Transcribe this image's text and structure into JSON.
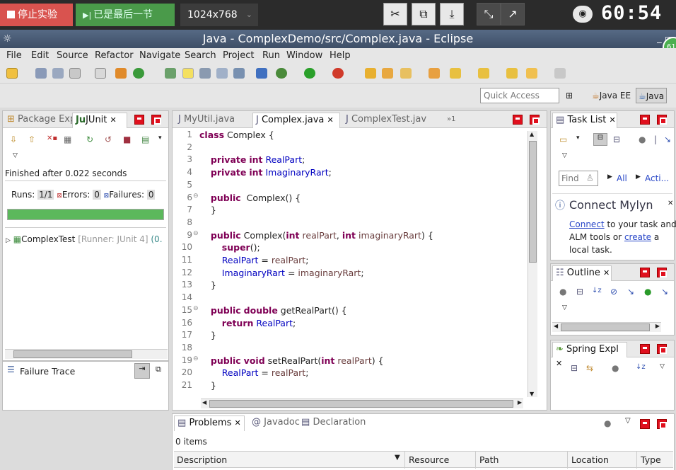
{
  "recorder": {
    "stop_label": "停止实验",
    "last_label": "已是最后一节",
    "resolution": "1024x768",
    "timer": "60:54",
    "badge": "61"
  },
  "window": {
    "title": "Java - ComplexDemo/src/Complex.java - Eclipse"
  },
  "menu": [
    "File",
    "Edit",
    "Source",
    "Refactor",
    "Navigate",
    "Search",
    "Project",
    "Run",
    "Window",
    "Help"
  ],
  "quick_access": {
    "placeholder": "Quick Access"
  },
  "perspectives": [
    "Java EE",
    "Java"
  ],
  "left_panel": {
    "tab_package": "Package Exp",
    "tab_junit": "JUnit",
    "finished": "Finished after 0.022 seconds",
    "runs_label": "Runs:",
    "runs_value": "1/1",
    "errors_label": "Errors:",
    "errors_value": "0",
    "failures_label": "Failures:",
    "failures_value": "0",
    "progress": 1.0,
    "progress_color": "#5cb85c",
    "test_name": "ComplexTest",
    "test_runner": "[Runner: JUnit 4]",
    "test_time": "(0.",
    "failure_trace": "Failure Trace"
  },
  "editor": {
    "tabs": [
      "MyUtil.java",
      "Complex.java",
      "ComplexTest.jav"
    ],
    "overflow": "»1",
    "lines": [
      {
        "n": "1",
        "fold": "",
        "segs": [
          [
            "kw",
            "class"
          ],
          [
            "t",
            " Complex {"
          ]
        ]
      },
      {
        "n": "2",
        "fold": "",
        "segs": []
      },
      {
        "n": "3",
        "fold": "",
        "segs": [
          [
            "t",
            "    "
          ],
          [
            "kw",
            "private"
          ],
          [
            "t",
            " "
          ],
          [
            "kw",
            "int"
          ],
          [
            "t",
            " "
          ],
          [
            "fld",
            "RealPart"
          ],
          [
            "t",
            ";"
          ]
        ]
      },
      {
        "n": "4",
        "fold": "",
        "segs": [
          [
            "t",
            "    "
          ],
          [
            "kw",
            "private"
          ],
          [
            "t",
            " "
          ],
          [
            "kw",
            "int"
          ],
          [
            "t",
            " "
          ],
          [
            "fld",
            "ImaginaryRart"
          ],
          [
            "t",
            ";"
          ]
        ]
      },
      {
        "n": "5",
        "fold": "",
        "segs": []
      },
      {
        "n": "6",
        "fold": "⊖",
        "segs": [
          [
            "t",
            "    "
          ],
          [
            "kw",
            "public"
          ],
          [
            "t",
            "  Complex() {"
          ]
        ]
      },
      {
        "n": "7",
        "fold": "",
        "segs": [
          [
            "t",
            "    }"
          ]
        ]
      },
      {
        "n": "8",
        "fold": "",
        "segs": []
      },
      {
        "n": "9",
        "fold": "⊖",
        "segs": [
          [
            "t",
            "    "
          ],
          [
            "kw",
            "public"
          ],
          [
            "t",
            " Complex("
          ],
          [
            "kw",
            "int"
          ],
          [
            "t",
            " "
          ],
          [
            "par",
            "realPart"
          ],
          [
            "t",
            ", "
          ],
          [
            "kw",
            "int"
          ],
          [
            "t",
            " "
          ],
          [
            "par",
            "imaginaryRart"
          ],
          [
            "t",
            ") {"
          ]
        ]
      },
      {
        "n": "10",
        "fold": "",
        "segs": [
          [
            "t",
            "        "
          ],
          [
            "kw",
            "super"
          ],
          [
            "t",
            "();"
          ]
        ]
      },
      {
        "n": "11",
        "fold": "",
        "segs": [
          [
            "t",
            "        "
          ],
          [
            "fld",
            "RealPart"
          ],
          [
            "t",
            " = "
          ],
          [
            "par",
            "realPart"
          ],
          [
            "t",
            ";"
          ]
        ]
      },
      {
        "n": "12",
        "fold": "",
        "segs": [
          [
            "t",
            "        "
          ],
          [
            "fld",
            "ImaginaryRart"
          ],
          [
            "t",
            " = "
          ],
          [
            "par",
            "imaginaryRart"
          ],
          [
            "t",
            ";"
          ]
        ]
      },
      {
        "n": "13",
        "fold": "",
        "segs": [
          [
            "t",
            "    }"
          ]
        ]
      },
      {
        "n": "14",
        "fold": "",
        "segs": []
      },
      {
        "n": "15",
        "fold": "⊖",
        "segs": [
          [
            "t",
            "    "
          ],
          [
            "kw",
            "public"
          ],
          [
            "t",
            " "
          ],
          [
            "kw",
            "double"
          ],
          [
            "t",
            " getRealPart() {"
          ]
        ]
      },
      {
        "n": "16",
        "fold": "",
        "segs": [
          [
            "t",
            "        "
          ],
          [
            "kw",
            "return"
          ],
          [
            "t",
            " "
          ],
          [
            "fld",
            "RealPart"
          ],
          [
            "t",
            ";"
          ]
        ]
      },
      {
        "n": "17",
        "fold": "",
        "segs": [
          [
            "t",
            "    }"
          ]
        ]
      },
      {
        "n": "18",
        "fold": "",
        "segs": []
      },
      {
        "n": "19",
        "fold": "⊖",
        "segs": [
          [
            "t",
            "    "
          ],
          [
            "kw",
            "public"
          ],
          [
            "t",
            " "
          ],
          [
            "kw",
            "void"
          ],
          [
            "t",
            " setRealPart("
          ],
          [
            "kw",
            "int"
          ],
          [
            "t",
            " "
          ],
          [
            "par",
            "realPart"
          ],
          [
            "t",
            ") {"
          ]
        ]
      },
      {
        "n": "20",
        "fold": "",
        "segs": [
          [
            "t",
            "        "
          ],
          [
            "fld",
            "RealPart"
          ],
          [
            "t",
            " = "
          ],
          [
            "par",
            "realPart"
          ],
          [
            "t",
            ";"
          ]
        ]
      },
      {
        "n": "21",
        "fold": "",
        "segs": [
          [
            "t",
            "    }"
          ]
        ]
      }
    ]
  },
  "task_list": {
    "title": "Task List",
    "find_placeholder": "Find",
    "all": "All",
    "acti": "Acti...",
    "mylyn_title": "Connect Mylyn",
    "mylyn_connect": "Connect",
    "mylyn_text1": " to your task and",
    "mylyn_text2a": "ALM tools or ",
    "mylyn_create": "create",
    "mylyn_text2b": " a",
    "mylyn_text3": "local task."
  },
  "outline": {
    "title": "Outline"
  },
  "spring": {
    "title": "Spring Expl"
  },
  "bottom": {
    "tab_problems": "Problems",
    "tab_javadoc": "Javadoc",
    "tab_declaration": "Declaration",
    "items": "0 items",
    "columns": [
      "Description",
      "Resource",
      "Path",
      "Location",
      "Type"
    ]
  }
}
